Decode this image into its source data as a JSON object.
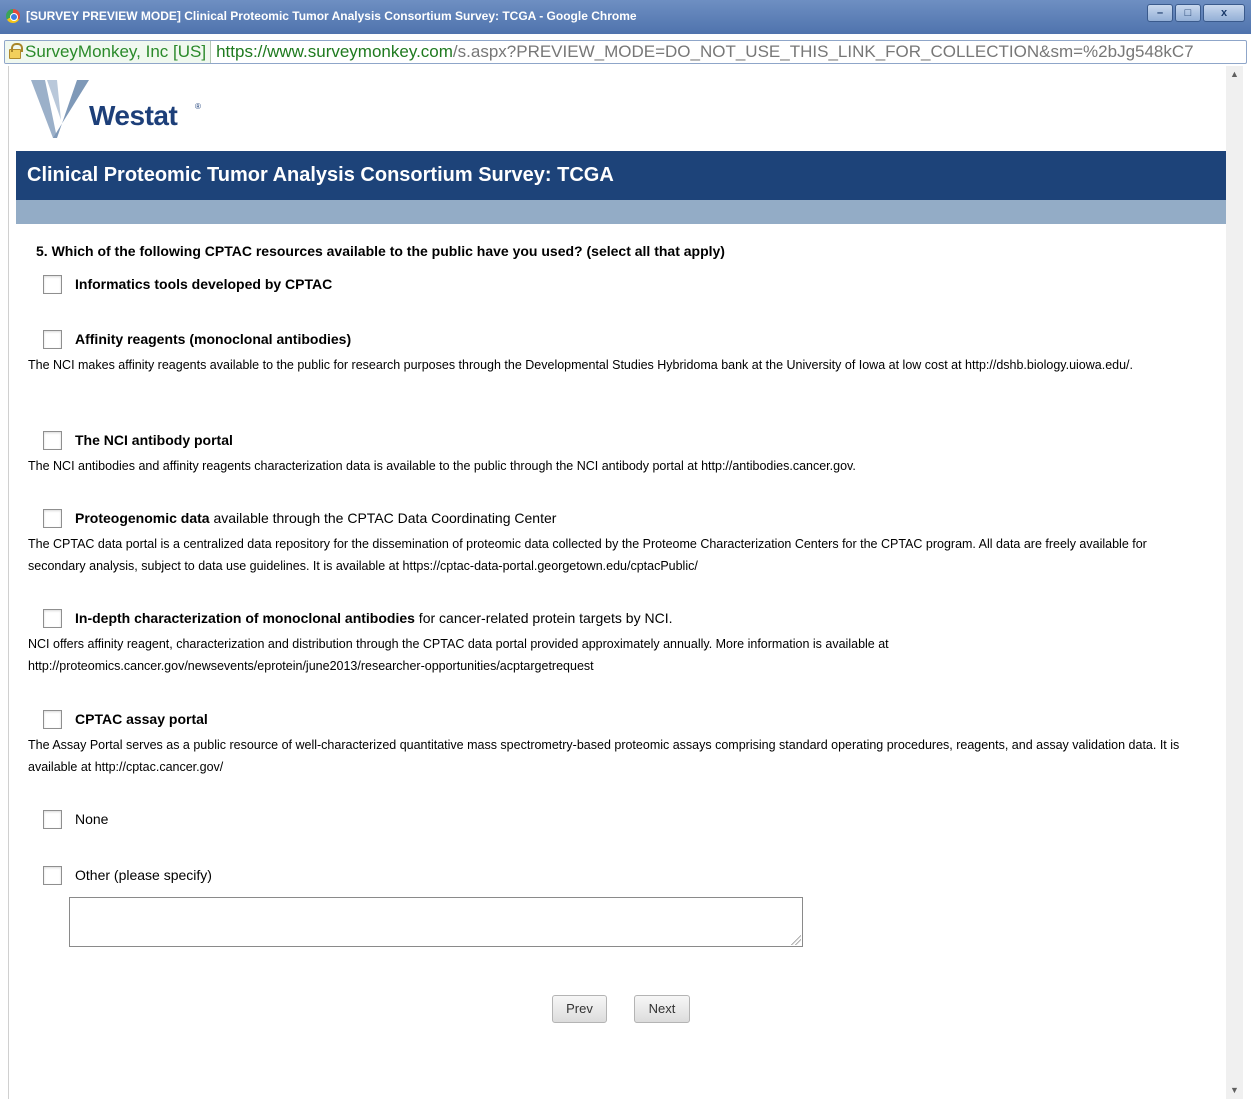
{
  "window": {
    "title": "[SURVEY PREVIEW MODE] Clinical Proteomic Tumor Analysis Consortium Survey: TCGA - Google Chrome",
    "controls": {
      "minimize": "–",
      "maximize": "□",
      "close": "x"
    }
  },
  "addressbar": {
    "ev_label": "SurveyMonkey, Inc [US]",
    "url_host": "https://www.surveymonkey.com",
    "url_path": "/s.aspx?PREVIEW_MODE=DO_NOT_USE_THIS_LINK_FOR_COLLECTION&sm=%2bJg548kC7"
  },
  "branding": {
    "logo_text": "Westat",
    "logo_reg": "®"
  },
  "survey": {
    "title": "Clinical Proteomic Tumor Analysis Consortium Survey: TCGA",
    "question": "5. Which of the following CPTAC resources available to the public have you used? (select all that apply)",
    "options": [
      {
        "bold": "Informatics tools developed by CPTAC",
        "rest": "",
        "desc": ""
      },
      {
        "bold": "Affinity reagents (monoclonal antibodies)",
        "rest": "",
        "desc": "The NCI makes affinity reagents available to the public for research purposes through the Developmental Studies Hybridoma bank at the University of Iowa at low cost at http://dshb.biology.uiowa.edu/."
      },
      {
        "bold": "The NCI antibody portal",
        "rest": "",
        "desc": "The NCI antibodies and affinity reagents characterization data is available to the public through the NCI antibody portal at http://antibodies.cancer.gov."
      },
      {
        "bold": "Proteogenomic data",
        "rest": " available through the CPTAC Data Coordinating Center",
        "desc": "The CPTAC data portal is a centralized data repository for the dissemination of proteomic data collected by the Proteome Characterization Centers for the CPTAC program. All data are freely available for secondary analysis, subject to data use guidelines. It is available at https://cptac-data-portal.georgetown.edu/cptacPublic/"
      },
      {
        "bold": "In-depth characterization of monoclonal antibodies",
        "rest": " for cancer-related protein targets by NCI.",
        "desc": "NCI offers affinity reagent, characterization and distribution through the CPTAC data portal provided approximately annually. More information is available at http://proteomics.cancer.gov/newsevents/eprotein/june2013/researcher-opportunities/acptargetrequest"
      },
      {
        "bold": "CPTAC assay portal",
        "rest": "",
        "desc": "The Assay Portal serves as a public resource of well-characterized quantitative mass spectrometry-based proteomic assays comprising standard operating procedures, reagents, and assay validation data. It is available at http://cptac.cancer.gov/"
      },
      {
        "bold": "",
        "rest": "None",
        "desc": ""
      },
      {
        "bold": "",
        "rest": "Other (please specify)",
        "desc": ""
      }
    ],
    "other_value": "",
    "prev_label": "Prev",
    "next_label": "Next"
  }
}
